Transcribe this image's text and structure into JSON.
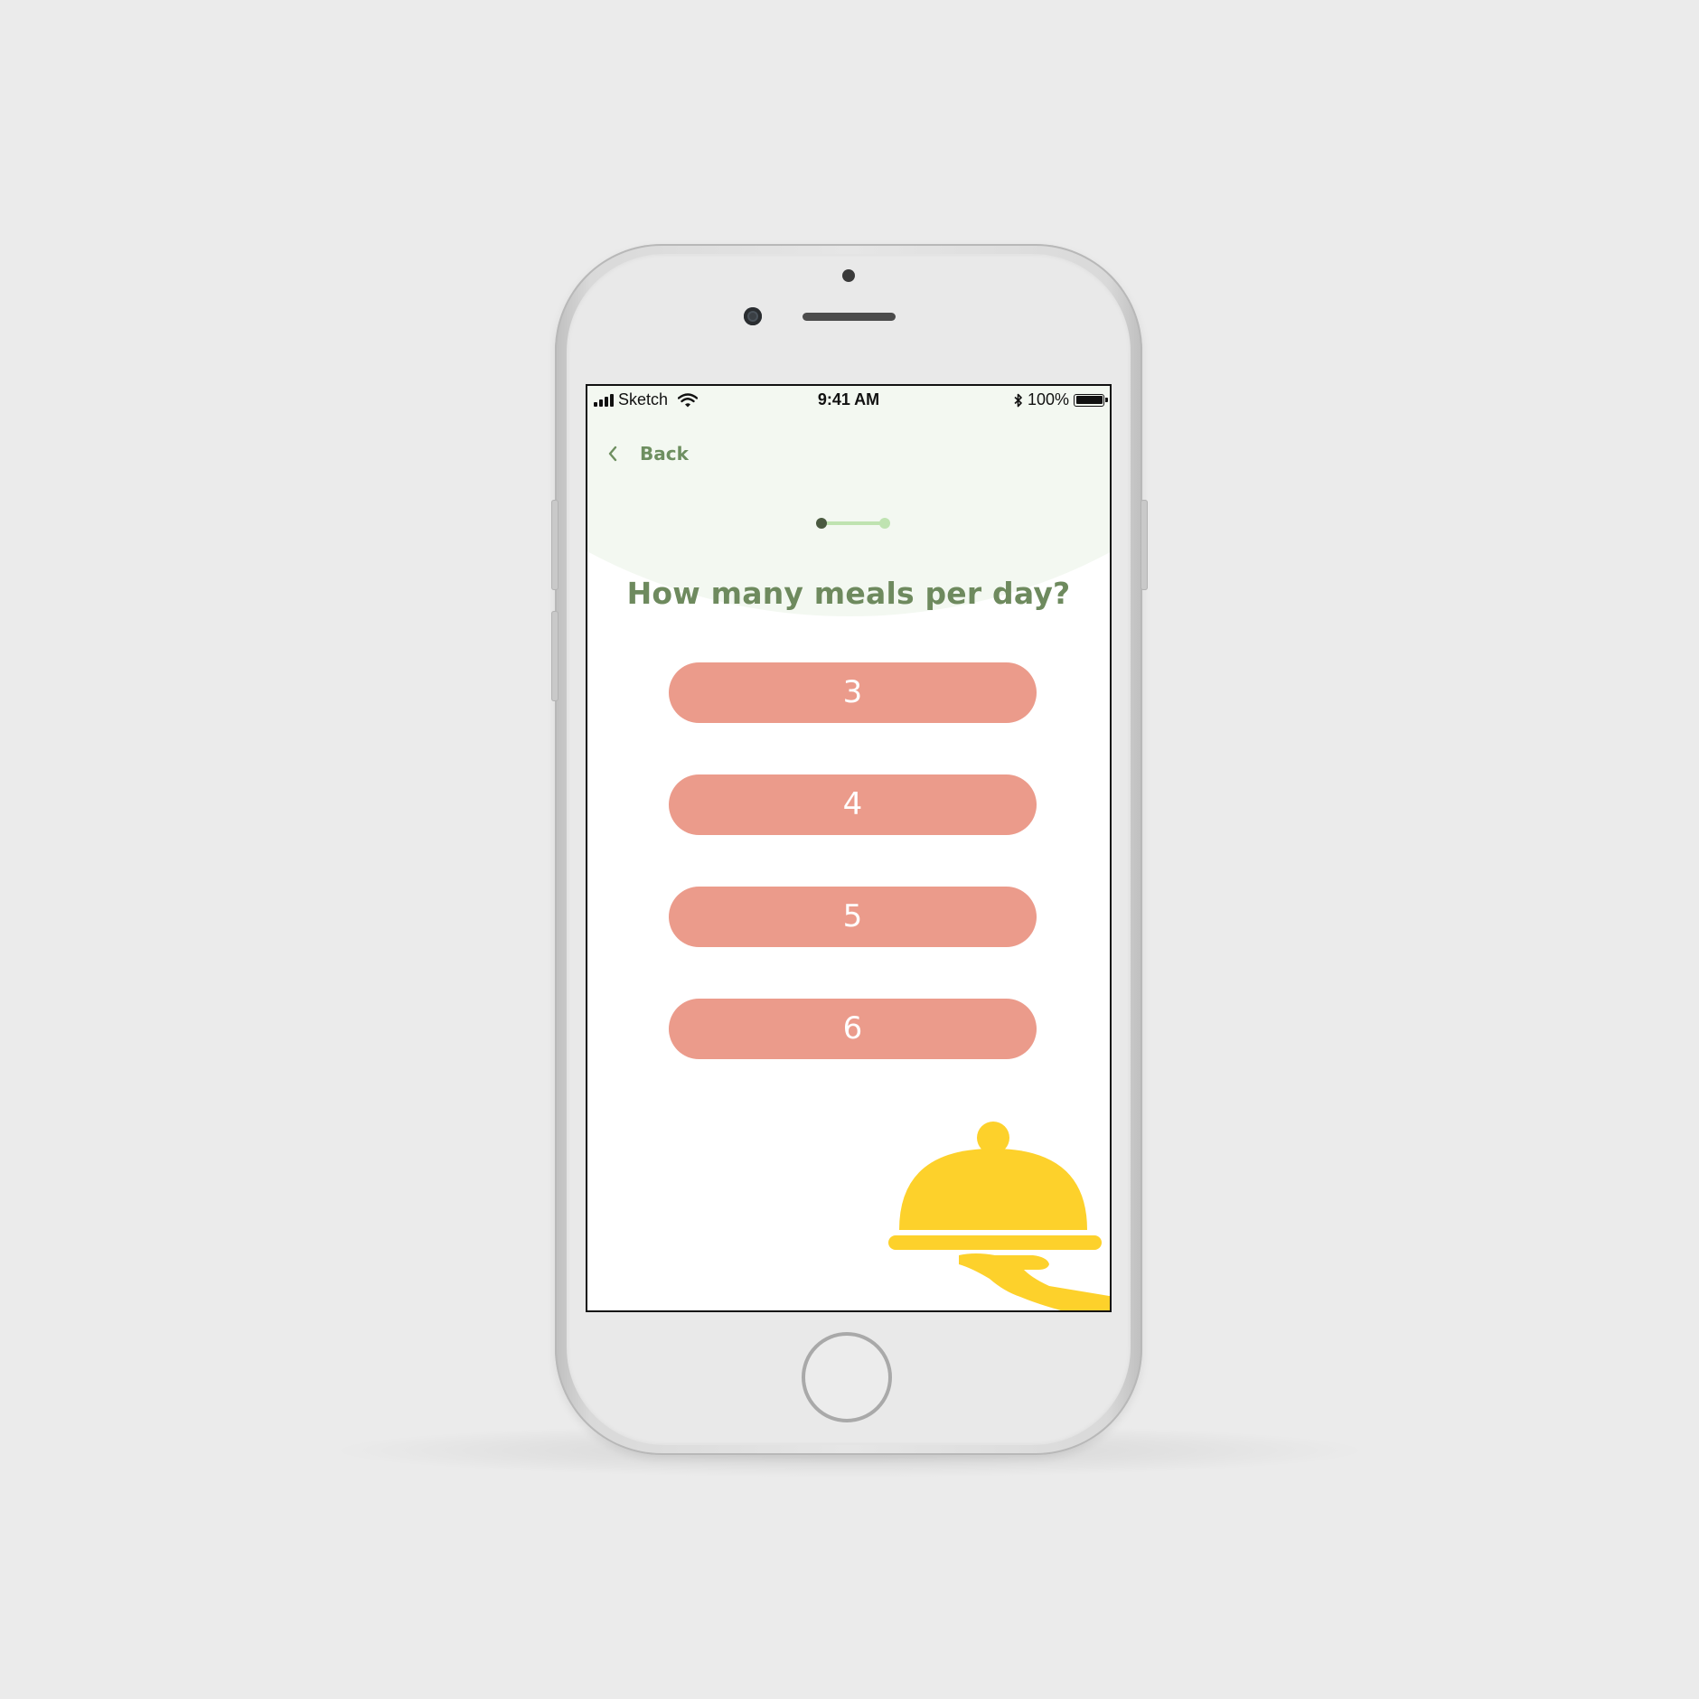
{
  "status_bar": {
    "carrier": "Sketch",
    "time": "9:41 AM",
    "battery": "100%"
  },
  "nav": {
    "back_label": "Back"
  },
  "progress": {
    "current_step": 1,
    "total_steps": 2
  },
  "question": {
    "title": "How many meals per day?"
  },
  "options": [
    {
      "label": "3"
    },
    {
      "label": "4"
    },
    {
      "label": "5"
    },
    {
      "label": "6"
    }
  ],
  "colors": {
    "page_background": "#ebebeb",
    "header_background": "#f3f8f1",
    "accent_green": "#6e8a5e",
    "progress_light": "#bfe3b1",
    "progress_dark": "#4a5a40",
    "option_background": "#eb9b8b",
    "illustration_yellow": "#fdd12b"
  },
  "icons": {
    "back": "chevron-left-icon",
    "illustration": "serving-cloche-icon"
  }
}
